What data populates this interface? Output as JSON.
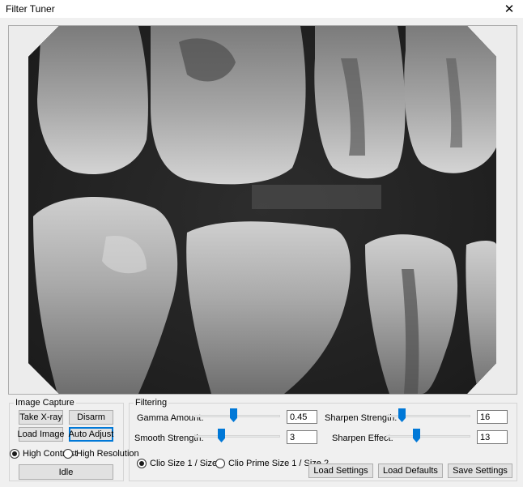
{
  "window": {
    "title": "Filter Tuner",
    "close_glyph": "✕"
  },
  "image_capture": {
    "legend": "Image Capture",
    "take_xray": "Take X-ray",
    "disarm": "Disarm",
    "load_image": "Load Image",
    "auto_adjust": "Auto Adjust",
    "mode_high_contrast": "High Contrast",
    "mode_high_resolution": "High Resolution",
    "selected_mode": "High Contrast",
    "status": "Idle"
  },
  "filtering": {
    "legend": "Filtering",
    "gamma_label": "Gamma Amount:",
    "gamma_value": "0.45",
    "gamma_level": 0.45,
    "smooth_label": "Smooth Strength:",
    "smooth_value": "3",
    "smooth_level": 0.3,
    "sharpen_strength_label": "Sharpen Strength:",
    "sharpen_strength_value": "16",
    "sharpen_strength_level": 0.16,
    "sharpen_effect_label": "Sharpen Effect:",
    "sharpen_effect_value": "13",
    "sharpen_effect_level": 0.35,
    "sensor_clio": "Clio Size 1 / Size 2",
    "sensor_clio_prime": "Clio Prime Size 1 / Size 2",
    "selected_sensor": "Clio Size 1 / Size 2",
    "load_settings": "Load Settings",
    "load_defaults": "Load Defaults",
    "save_settings": "Save Settings"
  },
  "colors": {
    "accent": "#0078d7",
    "button_face": "#e1e1e1",
    "window_bg": "#f0f0f0"
  }
}
